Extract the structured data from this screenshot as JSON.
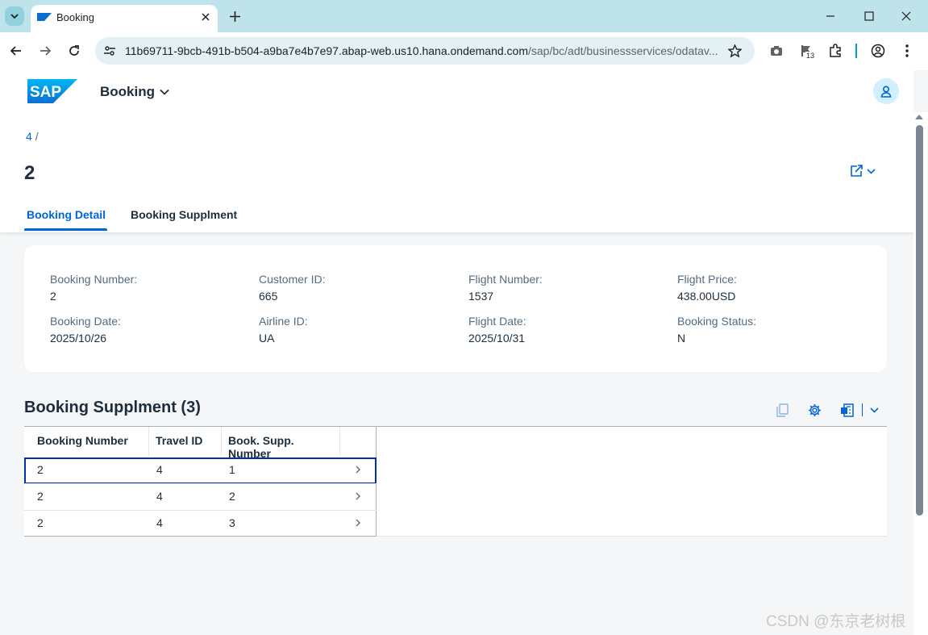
{
  "browser": {
    "tab_title": "Booking",
    "url_host": "11b69711-9bcb-491b-b504-a9ba7e4b7e97.abap-web.us10.hana.ondemand.com",
    "url_path": "/sap/bc/adt/businessservices/odatav...",
    "extension_badge": "13"
  },
  "shell": {
    "logo_text": "SAP",
    "app_title": "Booking"
  },
  "header": {
    "breadcrumb_link": "4",
    "breadcrumb_sep": "/",
    "title": "2",
    "tabs": [
      {
        "label": "Booking Detail"
      },
      {
        "label": "Booking Supplment"
      }
    ]
  },
  "details": {
    "booking_number": {
      "label": "Booking Number:",
      "value": "2"
    },
    "customer_id": {
      "label": "Customer ID:",
      "value": "665"
    },
    "flight_number": {
      "label": "Flight Number:",
      "value": "1537"
    },
    "flight_price": {
      "label": "Flight Price:",
      "value": "438.00USD"
    },
    "booking_date": {
      "label": "Booking Date:",
      "value": "2025/10/26"
    },
    "airline_id": {
      "label": "Airline ID:",
      "value": "UA"
    },
    "flight_date": {
      "label": "Flight Date:",
      "value": "2025/10/31"
    },
    "booking_status": {
      "label": "Booking Status:",
      "value": "N"
    }
  },
  "supplement": {
    "title": "Booking Supplment (3)",
    "columns": [
      "Booking Number",
      "Travel ID",
      "Book. Supp. Number"
    ],
    "rows": [
      [
        "2",
        "4",
        "1"
      ],
      [
        "2",
        "4",
        "2"
      ],
      [
        "2",
        "4",
        "3"
      ]
    ]
  },
  "watermark": "CSDN @东京老树根",
  "colors": {
    "accent": "#0064d9",
    "tabbar": "#bfe3ea",
    "focus": "#0032a5"
  }
}
